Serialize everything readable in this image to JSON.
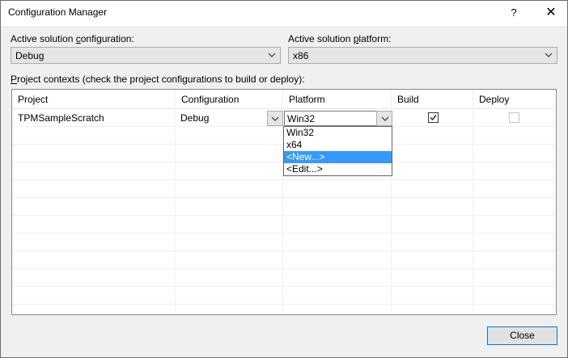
{
  "window": {
    "title": "Configuration Manager",
    "help": "?",
    "close_glyph": "✕"
  },
  "solution_config": {
    "label": "Active solution configuration:",
    "value": "Debug"
  },
  "solution_platform": {
    "label": "Active solution platform:",
    "value": "x86"
  },
  "contexts_label": "Project contexts (check the project configurations to build or deploy):",
  "grid": {
    "headers": [
      "Project",
      "Configuration",
      "Platform",
      "Build",
      "Deploy"
    ],
    "rows": [
      {
        "project": "TPMSampleScratch",
        "configuration": "Debug",
        "platform": "Win32",
        "build": true,
        "deploy": false
      }
    ]
  },
  "platform_dropdown": {
    "options": [
      "Win32",
      "x64",
      "<New...>",
      "<Edit...>"
    ],
    "highlighted": "<New...>"
  },
  "footer": {
    "close_label": "Close"
  },
  "colors": {
    "selection": "#3399ff",
    "focus_border": "#0078d7"
  },
  "icons": [
    "help-icon",
    "close-icon",
    "chevron-down-icon",
    "checkmark-icon"
  ]
}
